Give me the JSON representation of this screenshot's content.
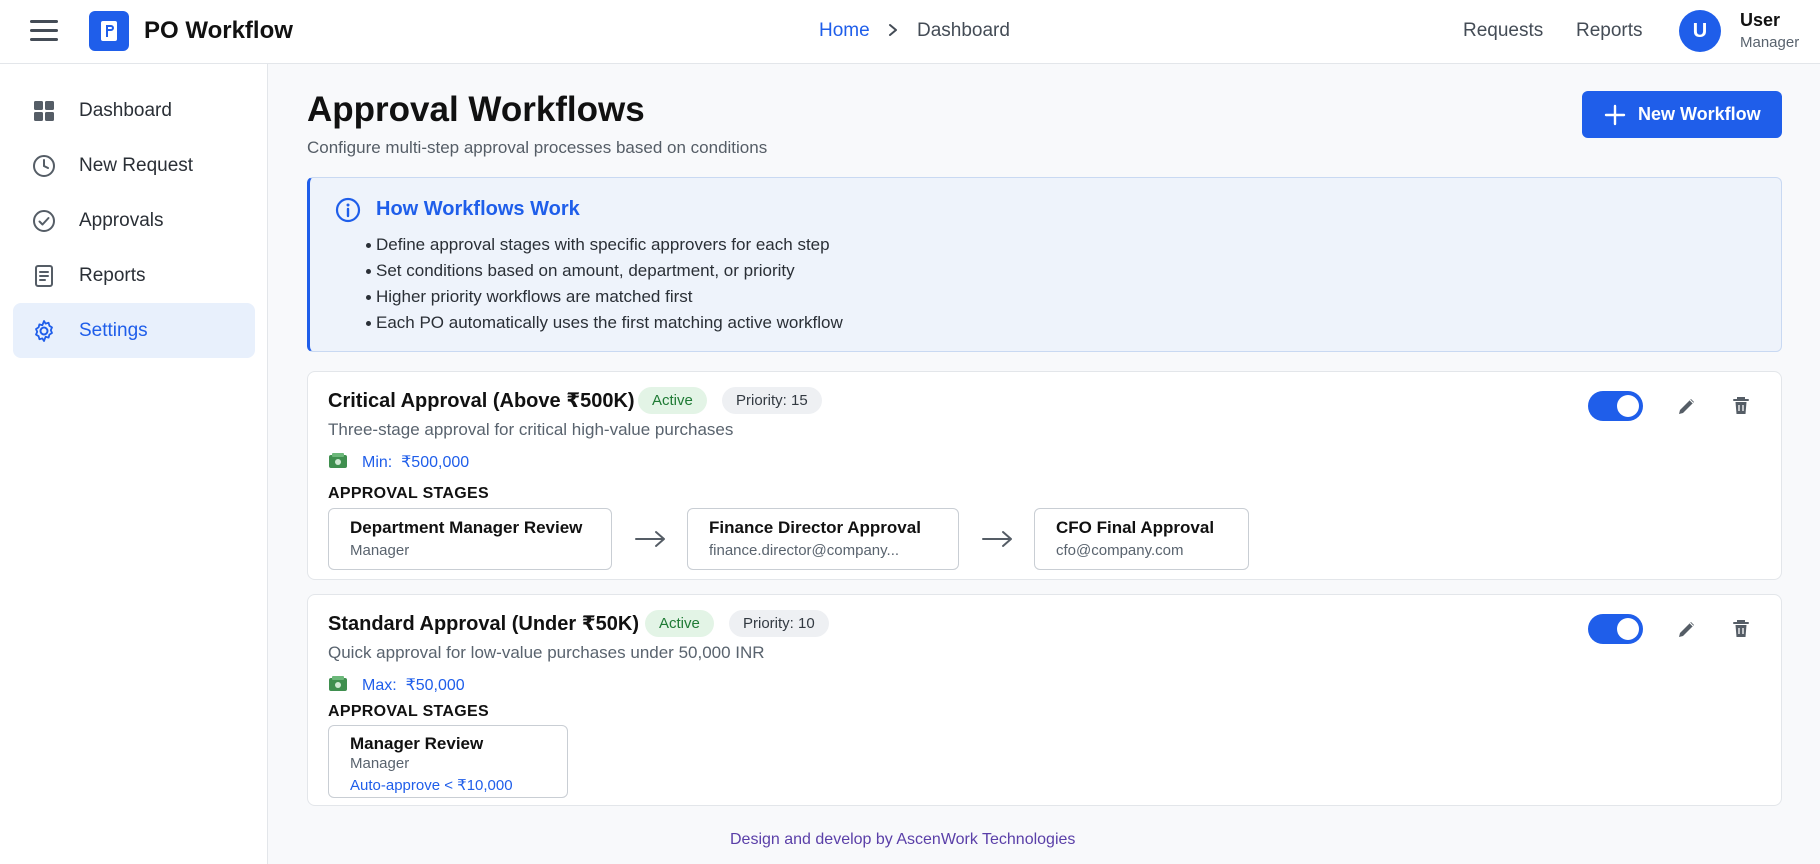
{
  "header": {
    "app_title": "PO Workflow",
    "breadcrumb": {
      "home": "Home",
      "current": "Dashboard"
    },
    "nav": {
      "requests": "Requests",
      "reports": "Reports"
    },
    "user": {
      "initial": "U",
      "name": "User",
      "role": "Manager"
    }
  },
  "sidebar": {
    "items": [
      {
        "label": "Dashboard",
        "icon": "dashboard-icon",
        "active": false
      },
      {
        "label": "New Request",
        "icon": "clock-icon",
        "active": false
      },
      {
        "label": "Approvals",
        "icon": "check-circle-icon",
        "active": false
      },
      {
        "label": "Reports",
        "icon": "document-icon",
        "active": false
      },
      {
        "label": "Settings",
        "icon": "gear-icon",
        "active": true
      }
    ]
  },
  "main": {
    "title": "Approval Workflows",
    "subtitle": "Configure multi-step approval processes based on conditions",
    "new_button": "New Workflow",
    "info": {
      "title": "How Workflows Work",
      "items": [
        "Define approval stages with specific approvers for each step",
        "Set conditions based on amount, department, or priority",
        "Higher priority workflows are matched first",
        "Each PO automatically uses the first matching active workflow"
      ]
    },
    "stages_label": "APPROVAL STAGES",
    "workflows": [
      {
        "name": "Critical Approval (Above ₹500K)",
        "status": "Active",
        "priority": "Priority: 15",
        "description": "Three-stage approval for critical high-value purchases",
        "limit_label": "Min:",
        "limit_value": "₹500,000",
        "enabled": true,
        "stages": [
          {
            "name": "Department Manager Review",
            "sub": "Manager"
          },
          {
            "name": "Finance Director Approval",
            "sub": "finance.director@company..."
          },
          {
            "name": "CFO Final Approval",
            "sub": "cfo@company.com"
          }
        ]
      },
      {
        "name": "Standard Approval (Under ₹50K)",
        "status": "Active",
        "priority": "Priority: 10",
        "description": "Quick approval for low-value purchases under 50,000 INR",
        "limit_label": "Max:",
        "limit_value": "₹50,000",
        "enabled": true,
        "stages": [
          {
            "name": "Manager Review",
            "sub": "Manager",
            "rule": "Auto-approve < ₹10,000"
          }
        ]
      }
    ]
  },
  "footer": "Design and develop by AscenWork Technologies",
  "colors": {
    "accent": "#1f5eea",
    "active_badge_bg": "#e3f4e6",
    "active_badge_text": "#1e7a34"
  }
}
